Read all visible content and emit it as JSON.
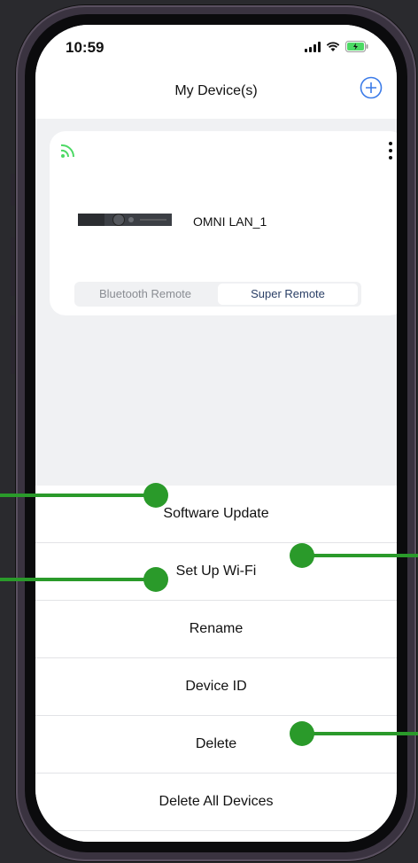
{
  "status_bar": {
    "time": "10:59"
  },
  "header": {
    "title": "My Device(s)"
  },
  "device_card": {
    "device_name": "OMNI LAN_1",
    "segments": [
      "Bluetooth Remote",
      "Super Remote"
    ],
    "selected_segment": "Super Remote"
  },
  "action_sheet": {
    "items": [
      "Software Update",
      "Set Up Wi-Fi",
      "Rename",
      "Device ID",
      "Delete",
      "Delete All Devices"
    ]
  },
  "colors": {
    "accent": "#3b7be8",
    "wifi_green": "#4cd964",
    "annotation_green": "#2a9a2a"
  },
  "icons": [
    "add-icon",
    "wifi-icon",
    "more-icon",
    "signal-icon",
    "battery-icon"
  ]
}
